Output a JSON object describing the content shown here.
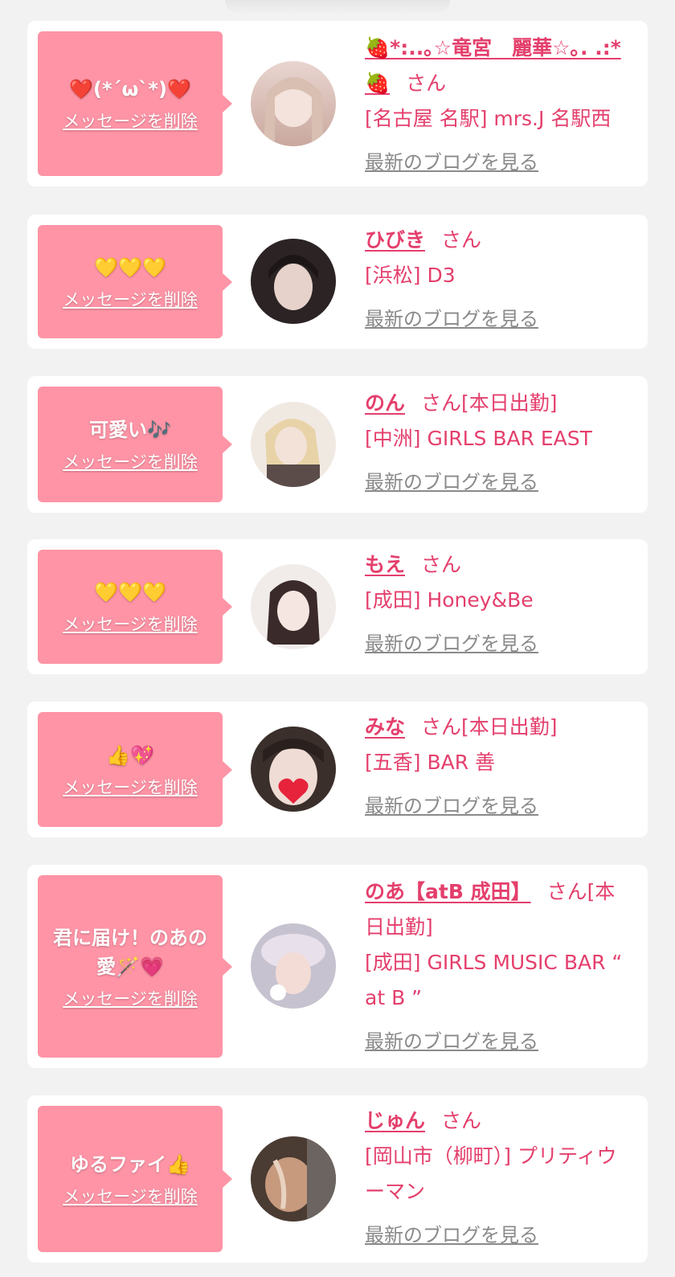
{
  "favorites": [
    {
      "message": "❤️(*´ω`*)❤️",
      "delete_label": "メッセージを削除",
      "name": "🍓*:..｡☆竜宮　麗華☆｡. .:*🍓",
      "honorific": "さん",
      "status": "",
      "shop": "[名古屋 名駅] mrs.J 名駅西",
      "blog_label": "最新のブログを見る",
      "avatar_colors": [
        "#e9d5d0",
        "#c9a89e"
      ]
    },
    {
      "message": "💛💛💛",
      "delete_label": "メッセージを削除",
      "name": "ひびき",
      "honorific": "さん",
      "status": "",
      "shop": "[浜松] D3",
      "blog_label": "最新のブログを見る",
      "avatar_colors": [
        "#2c2424",
        "#d9c4bd"
      ]
    },
    {
      "message": "可愛い🎶",
      "delete_label": "メッセージを削除",
      "name": "のん",
      "honorific": "さん",
      "status": "[本日出勤]",
      "shop": "[中洲] GIRLS BAR EAST",
      "blog_label": "最新のブログを見る",
      "avatar_colors": [
        "#e8d3a8",
        "#5b4c49"
      ]
    },
    {
      "message": "💛💛💛",
      "delete_label": "メッセージを削除",
      "name": "もえ",
      "honorific": "さん",
      "status": "",
      "shop": "[成田] Honey&Be",
      "blog_label": "最新のブログを見る",
      "avatar_colors": [
        "#f1ecea",
        "#3a2a2a"
      ]
    },
    {
      "message": "👍💖",
      "delete_label": "メッセージを削除",
      "name": "みな",
      "honorific": "さん",
      "status": "[本日出勤]",
      "shop": "[五香] BAR 善",
      "blog_label": "最新のブログを見る",
      "avatar_colors": [
        "#3b2f2c",
        "#e6233b"
      ]
    },
    {
      "message": "君に届け！のあの愛🪄💗",
      "delete_label": "メッセージを削除",
      "name": "のあ【atB 成田】",
      "honorific": "さん",
      "status": "[本日出勤]",
      "shop": "[成田] GIRLS MUSIC BAR “ at B ”",
      "blog_label": "最新のブログを見る",
      "avatar_colors": [
        "#c6c2cf",
        "#f3dcd6"
      ]
    },
    {
      "message": "ゆるファイ👍",
      "delete_label": "メッセージを削除",
      "name": "じゅん",
      "honorific": "さん",
      "status": "",
      "shop": "[岡山市（柳町）] プリティウーマン",
      "blog_label": "最新のブログを見る",
      "avatar_colors": [
        "#4a3b33",
        "#c79a7e"
      ]
    }
  ]
}
